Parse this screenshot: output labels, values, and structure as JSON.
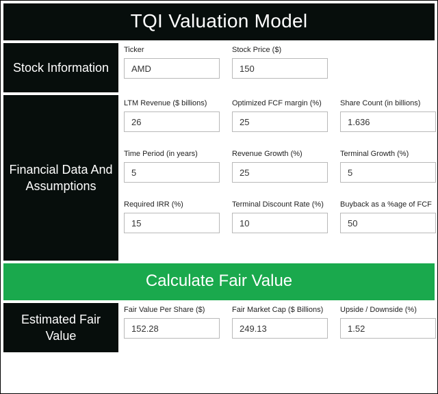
{
  "title": "TQI Valuation Model",
  "sections": {
    "stock": {
      "label": "Stock Information",
      "rows": [
        [
          {
            "label": "Ticker",
            "value": "AMD"
          },
          {
            "label": "Stock Price ($)",
            "value": "150"
          }
        ]
      ]
    },
    "financial": {
      "label": "Financial Data And Assumptions",
      "rows": [
        [
          {
            "label": "LTM Revenue ($ billions)",
            "value": "26"
          },
          {
            "label": "Optimized FCF margin (%)",
            "value": "25"
          },
          {
            "label": "Share Count (in billions)",
            "value": "1.636"
          }
        ],
        [
          {
            "label": "Time Period (in years)",
            "value": "5"
          },
          {
            "label": "Revenue Growth (%)",
            "value": "25"
          },
          {
            "label": "Terminal Growth (%)",
            "value": "5"
          }
        ],
        [
          {
            "label": "Required IRR (%)",
            "value": "15"
          },
          {
            "label": "Terminal Discount Rate (%)",
            "value": "10"
          },
          {
            "label": "Buyback as a %age of FCF",
            "value": "50"
          }
        ]
      ]
    },
    "estimated": {
      "label": "Estimated Fair Value",
      "rows": [
        [
          {
            "label": "Fair Value Per Share ($)",
            "value": "152.28"
          },
          {
            "label": "Fair Market Cap ($ Billions)",
            "value": "249.13"
          },
          {
            "label": "Upside / Downside (%)",
            "value": "1.52"
          }
        ]
      ]
    }
  },
  "calculate_label": "Calculate Fair Value",
  "colors": {
    "dark": "#070e0c",
    "green": "#1aa94d",
    "border": "#b8b8b8"
  }
}
